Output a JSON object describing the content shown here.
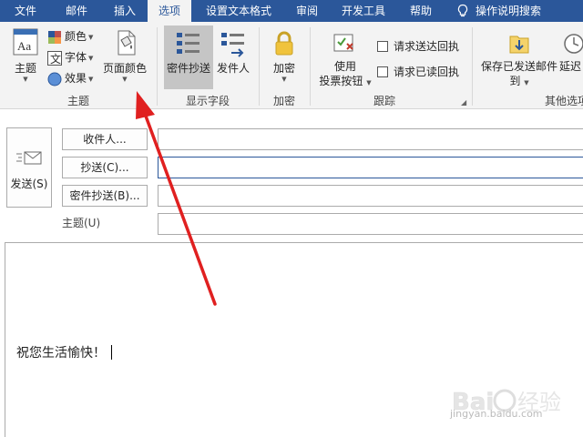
{
  "menu": {
    "items": [
      "文件",
      "邮件",
      "插入",
      "选项",
      "设置文本格式",
      "审阅",
      "开发工具",
      "帮助",
      "操作说明搜索"
    ],
    "active": "选项"
  },
  "ribbon": {
    "themes": {
      "theme_label": "主题",
      "colors_label": "颜色",
      "fonts_label": "字体",
      "effects_label": "效果",
      "page_color_label": "页面颜色",
      "group_label": "主题"
    },
    "show_fields": {
      "bcc_label": "密件抄送",
      "from_label": "发件人",
      "group_label": "显示字段"
    },
    "encrypt": {
      "encrypt_label": "加密",
      "group_label": "加密"
    },
    "tracking": {
      "voting_label_1": "使用",
      "voting_label_2": "投票按钮",
      "request_delivery": "请求送达回执",
      "request_read": "请求已读回执",
      "group_label": "跟踪"
    },
    "more": {
      "save_sent_1": "保存已发送邮件",
      "save_sent_2": "到",
      "delay_label": "延迟",
      "group_label": "其他选项"
    }
  },
  "compose": {
    "send_label": "发送(S)",
    "to_label": "收件人...",
    "cc_label": "抄送(C)...",
    "bcc_label": "密件抄送(B)...",
    "subject_label": "主题(U)",
    "body_text": "祝您生活愉快！"
  },
  "watermark": {
    "site": "jingyan.baidu.com"
  },
  "colors": {
    "accent": "#2b579a",
    "ribbon_bg": "#f3f3f3",
    "annotation": "#e02020"
  }
}
